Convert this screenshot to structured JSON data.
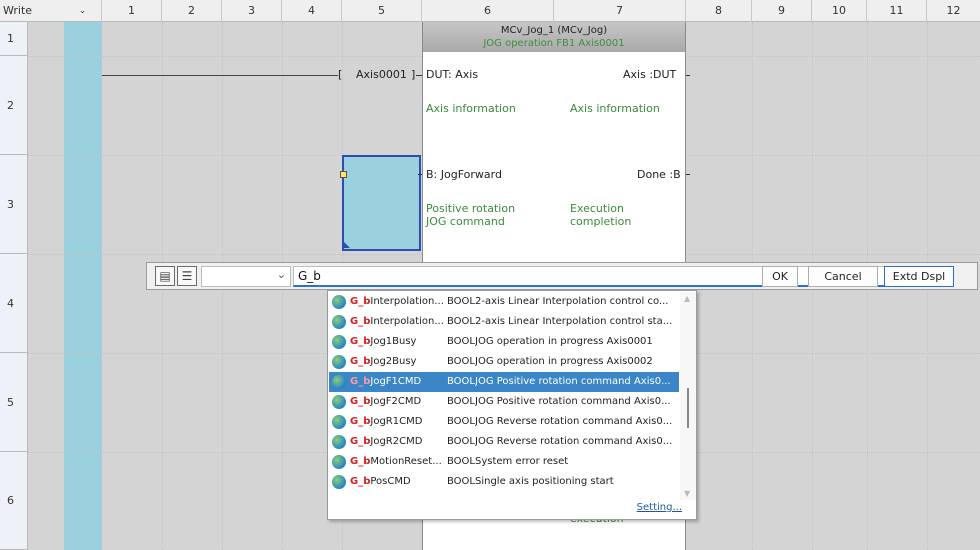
{
  "header": {
    "mode": "Write",
    "dropdown_glyph": "⌄",
    "columns": [
      "1",
      "2",
      "3",
      "4",
      "5",
      "6",
      "7",
      "8",
      "9",
      "10",
      "11",
      "12"
    ]
  },
  "rows": [
    "1",
    "2",
    "3",
    "4",
    "5",
    "6"
  ],
  "fb": {
    "instance": "MCv_Jog_1  (MCv_Jog)",
    "comment": "JOG operation FB1 Axis0001",
    "in1": "DUT: Axis",
    "out1": "Axis :DUT",
    "in1_comment": "Axis information",
    "out1_comment": "Axis information",
    "in2": "B: JogForward",
    "out2": "Done :B",
    "in2_comment_1": "Positive rotation",
    "in2_comment_2": "JOG command",
    "out2_comment_1": "Execution",
    "out2_comment_2": "completion",
    "bottom_comment": "execution"
  },
  "ladder": {
    "device_label": "Axis0001"
  },
  "input_bar": {
    "icon1": "device-list-icon",
    "icon2": "comment-icon",
    "combo_value": "",
    "text_value": "G_b",
    "ok_label": "OK",
    "cancel_label": "Cancel",
    "extd_label": "Extd Dspl"
  },
  "autocomplete": {
    "highlight_prefix": "G_b",
    "selected_index": 4,
    "items": [
      {
        "rest": "Interpolation...",
        "type": "BOOL",
        "desc": "2-axis Linear Interpolation control co..."
      },
      {
        "rest": "Interpolation...",
        "type": "BOOL",
        "desc": "2-axis Linear Interpolation control sta..."
      },
      {
        "rest": "Jog1Busy",
        "type": "BOOL",
        "desc": "JOG operation in progress Axis0001"
      },
      {
        "rest": "Jog2Busy",
        "type": "BOOL",
        "desc": "JOG operation in progress Axis0002"
      },
      {
        "rest": "JogF1CMD",
        "type": "BOOL",
        "desc": "JOG Positive rotation command Axis0..."
      },
      {
        "rest": "JogF2CMD",
        "type": "BOOL",
        "desc": "JOG Positive rotation command Axis0..."
      },
      {
        "rest": "JogR1CMD",
        "type": "BOOL",
        "desc": "JOG Reverse rotation command Axis0..."
      },
      {
        "rest": "JogR2CMD",
        "type": "BOOL",
        "desc": "JOG Reverse rotation command Axis0..."
      },
      {
        "rest": "MotionReset...",
        "type": "BOOL",
        "desc": "System error reset"
      },
      {
        "rest": "PosCMD",
        "type": "BOOL",
        "desc": "Single axis positioning start"
      }
    ],
    "setting_link": "Setting..."
  }
}
